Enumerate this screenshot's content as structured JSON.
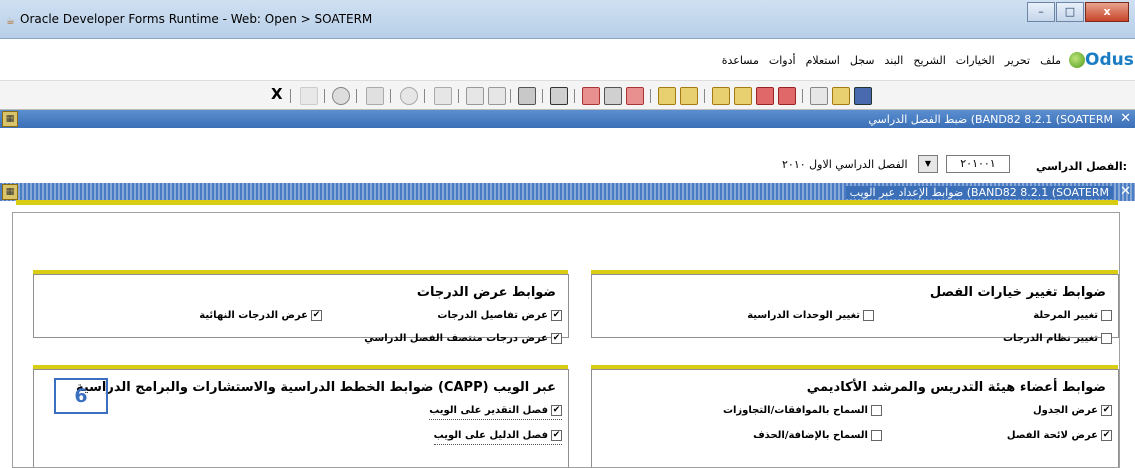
{
  "window": {
    "title": "Oracle Developer Forms Runtime - Web:  Open > SOATERM",
    "buttons": [
      "–",
      "□",
      "x"
    ]
  },
  "logo": {
    "text": "Odus"
  },
  "menu": [
    "ملف",
    "تحرير",
    "الخيارات",
    "الشريح",
    "البند",
    "سجل",
    "استعلام",
    "أدوات",
    "مساعدة"
  ],
  "toolbar": {
    "exit_label": "X"
  },
  "form1": {
    "title": "ضبط الفصل الدراسي  (BAND82  8.2.1  (SOATERM"
  },
  "term": {
    "label": "الفصل الدراسي:",
    "code": "٢٠١٠٠١",
    "description": "الفصل الدراسي الاول ٢٠١٠"
  },
  "form2": {
    "title": "ضوابط الإعداد عبر الويب  (BAND82  8.2.1  (SOATERM"
  },
  "panels": {
    "registration": {
      "title": "ضوابط تغيير خيارات الفصل",
      "items": [
        {
          "label": "تغيير المرحلة",
          "checked": false
        },
        {
          "label": "تغيير الوحدات الدراسية",
          "checked": false
        },
        {
          "label": "تغيير نظام الدرجات",
          "checked": false
        }
      ]
    },
    "grades": {
      "title": "ضوابط عرض الدرجات",
      "items": [
        {
          "label": "عرض تفاصيل الدرجات",
          "checked": true
        },
        {
          "label": "عرض الدرجات النهائية",
          "checked": true
        },
        {
          "label": "عرض درجات منتصف الفصل الدراسي",
          "checked": true
        }
      ]
    },
    "faculty": {
      "title": "ضوابط أعضاء هيئة التدريس والمرشد الأكاديمي",
      "items": [
        {
          "label": "عرض الجدول",
          "checked": true
        },
        {
          "label": "السماح بالموافقات/التجاوزات",
          "checked": false
        },
        {
          "label": "عرض لائحة الفصل",
          "checked": true
        },
        {
          "label": "السماح بالإضافة/الحذف",
          "checked": false
        }
      ]
    },
    "capp": {
      "title": "ضوابط الخطط الدراسية والاستشارات والبرامج الدراسية (CAPP) عبر الويب",
      "items": [
        {
          "label": "فصل التقدير على الويب",
          "checked": true
        },
        {
          "label": "فصل الدليل على الويب",
          "checked": true
        }
      ]
    }
  },
  "annotation": {
    "number": "6"
  },
  "check_mark": "✔",
  "colors": {
    "accent": "#d8cd12",
    "header": "#3b6fb7"
  }
}
